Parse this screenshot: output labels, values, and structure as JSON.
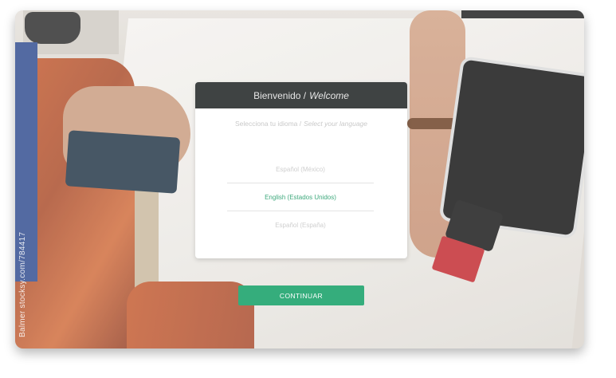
{
  "dialog": {
    "title_es": "Bienvenido /",
    "title_en": "Welcome",
    "subtitle_es": "Selecciona tu idioma /",
    "subtitle_en": "Select your language"
  },
  "languages": [
    {
      "label": "Español (México)",
      "selected": false
    },
    {
      "label": "English (Estados Unidos)",
      "selected": true
    },
    {
      "label": "Español (España)",
      "selected": false
    }
  ],
  "continue_label": "CONTINUAR",
  "watermark": "Balmer  stocksy.com/784417",
  "colors": {
    "header_bg": "#3f4343",
    "accent_green": "#35ad7c",
    "selected_text": "#3fa97d"
  }
}
